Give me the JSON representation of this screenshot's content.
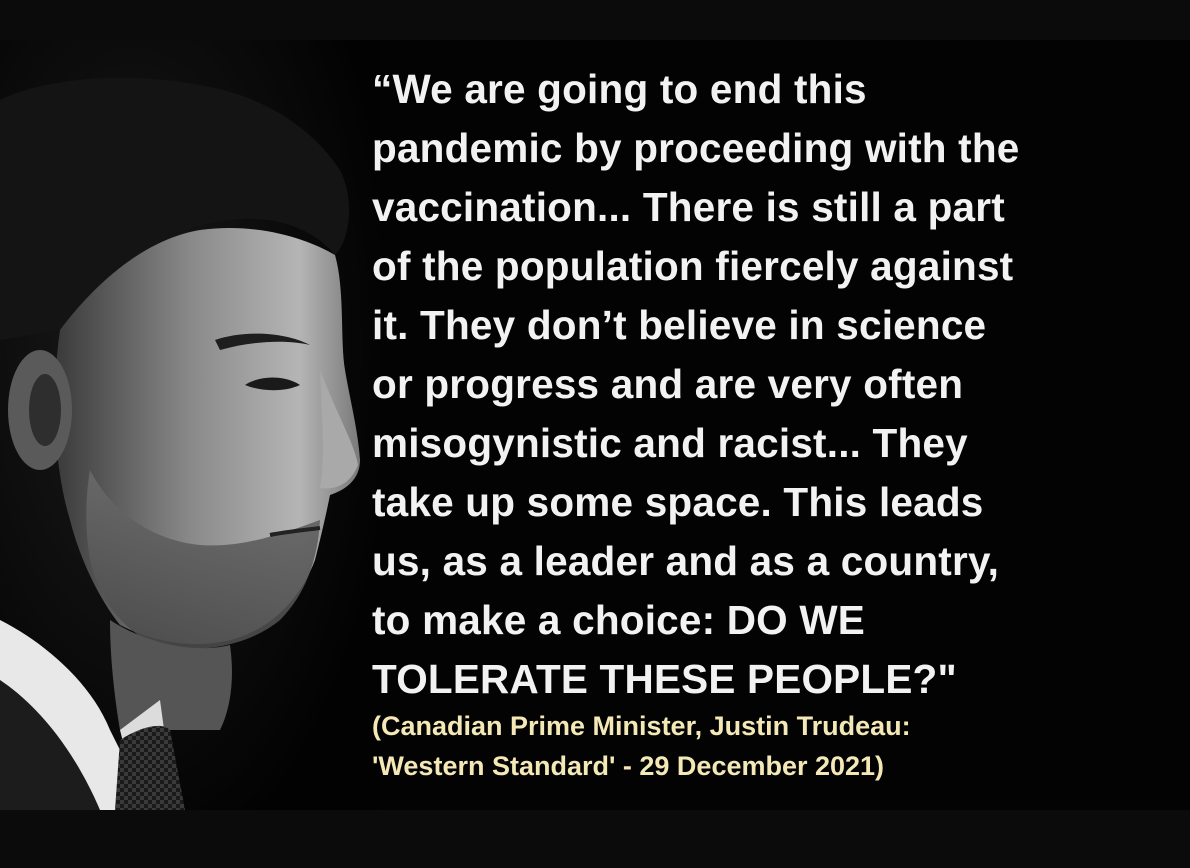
{
  "quote": {
    "lines": [
      "“We are going to end this",
      "pandemic by proceeding with the",
      "vaccination... There is still a part",
      "of the population fiercely against",
      "it. They don’t believe in science",
      "or progress and are very often",
      "misogynistic and racist... They",
      "take up some space. This leads",
      "us, as a leader and as a country,",
      "to make a choice: DO WE",
      "TOLERATE THESE PEOPLE?\""
    ]
  },
  "attribution": {
    "lines": [
      "(Canadian Prime Minister, Justin Trudeau:",
      "'Western Standard' - 29 December 2021)"
    ]
  },
  "colors": {
    "background": "#030303",
    "quote_text": "#f2f2f2",
    "attribution_text": "#f4e9b6"
  }
}
